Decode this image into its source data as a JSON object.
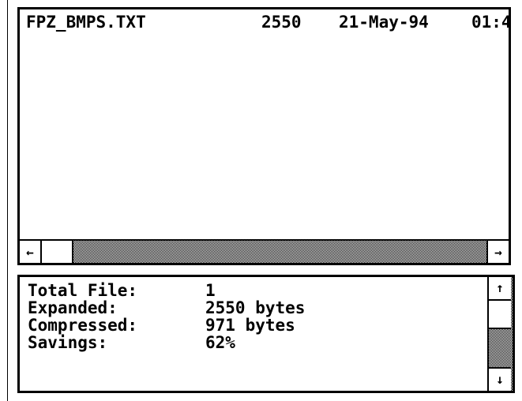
{
  "file_list": {
    "rows": [
      {
        "name": "FPZ_BMPS.TXT",
        "size": "2550",
        "date": "21-May-94",
        "time": "01:4"
      }
    ],
    "scroll_left_icon": "←",
    "scroll_right_icon": "→"
  },
  "summary": {
    "total_file_label": "Total File:",
    "total_file_value": "1",
    "expanded_label": "Expanded:",
    "expanded_value": "2550 bytes",
    "compressed_label": "Compressed:",
    "compressed_value": "971 bytes",
    "savings_label": "Savings:",
    "savings_value": "62%",
    "scroll_up_icon": "↑",
    "scroll_down_icon": "↓"
  }
}
